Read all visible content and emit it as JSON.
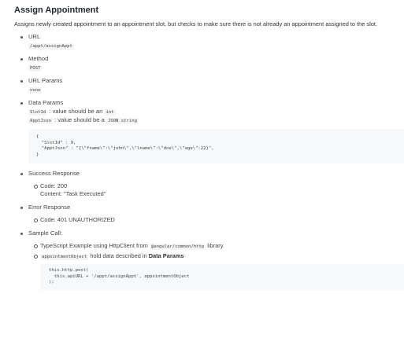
{
  "title": "Assign Appointment",
  "description": "Assigns newly created appointment to an appointment slot, but checks to make sure there is not already an appointment assigned to the slot.",
  "url": {
    "label": "URL",
    "value": "/appt/assignAppt"
  },
  "method": {
    "label": "Method",
    "value": "POST"
  },
  "url_params": {
    "label": "URL Params",
    "value": "none"
  },
  "data_params": {
    "label": "Data Params",
    "line1_code": "SlotId",
    "line1_text": ": value should be an",
    "line1_type": "int",
    "line2_code": "ApptJson",
    "line2_text": ": value should be a",
    "line2_type": "JSON string",
    "code_block": "{\n  \"SlotId\" : 9,\n  \"ApptJson\" : \"{\\\"fname\\\":\\\"john\\\",\\\"lname\\\":\\\"doe\\\",\\\"age\\\":22}\",\n}"
  },
  "success_response": {
    "label": "Success Response",
    "code": "Code: 200",
    "content": "Content: \"Task Executed\""
  },
  "error_response": {
    "label": "Error Response",
    "code": "Code: 401 UNAUTHORIZED"
  },
  "sample_call": {
    "label": "Sample Call:",
    "item1_text": "TypeScript Example using HttpClient from",
    "item1_code": "@angular/common/http",
    "item1_suffix": "library.",
    "item2_code": "appointmentObject",
    "item2_text": "hold data described in",
    "item2_bold": "Data Params",
    "code_block": "this.http.post(\n  this.apiURL + '/appt/assignAppt', appointmentObject\n);"
  }
}
